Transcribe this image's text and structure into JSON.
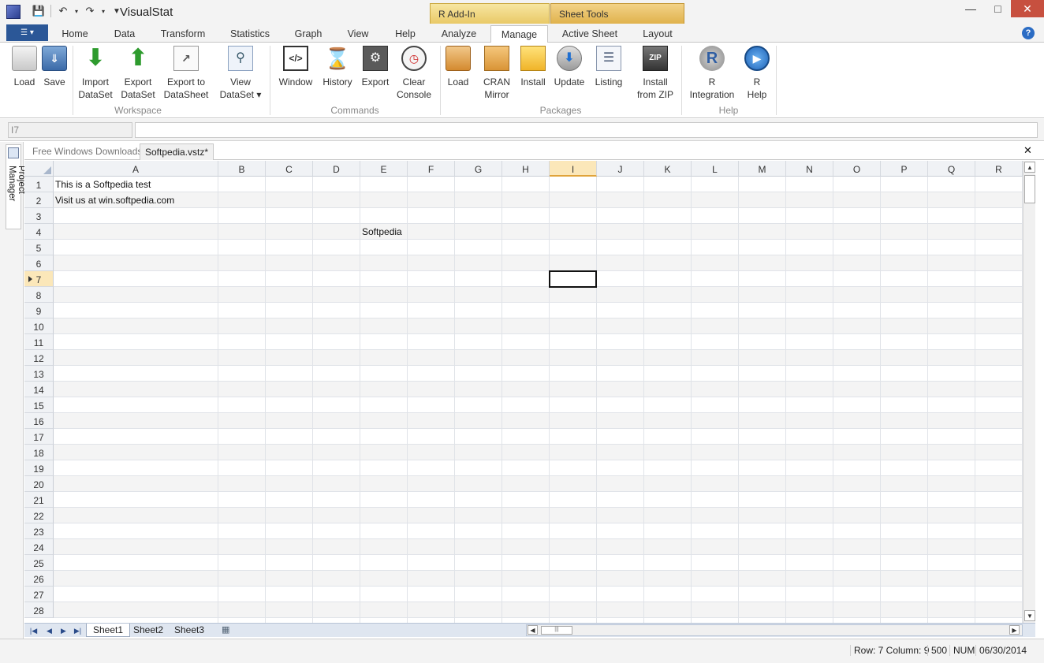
{
  "app": {
    "title": "VisualStat"
  },
  "context_groups": {
    "r_addin": "R Add-In",
    "sheet_tools": "Sheet Tools"
  },
  "tabs": [
    "Home",
    "Data",
    "Transform",
    "Statistics",
    "Graph",
    "View",
    "Help",
    "Analyze",
    "Manage",
    "Active Sheet",
    "Layout"
  ],
  "active_tab": "Manage",
  "ribbon": {
    "workspace": {
      "label": "Workspace",
      "load": "Load",
      "save": "Save",
      "import": [
        "Import",
        "DataSet"
      ],
      "export": [
        "Export",
        "DataSet"
      ],
      "export_sheet": [
        "Export to",
        "DataSheet"
      ],
      "view": [
        "View",
        "DataSet ▾"
      ]
    },
    "commands": {
      "label": "Commands",
      "window": "Window",
      "history": "History",
      "export": "Export",
      "clear": [
        "Clear",
        "Console"
      ]
    },
    "packages": {
      "label": "Packages",
      "load": "Load",
      "cran": [
        "CRAN",
        "Mirror"
      ],
      "install": "Install",
      "update": "Update",
      "listing": "Listing",
      "install_zip": [
        "Install",
        "from ZIP"
      ]
    },
    "help": {
      "label": "Help",
      "r_integration": [
        "R",
        "Integration"
      ],
      "r_help": [
        "R",
        "Help"
      ]
    }
  },
  "formula_bar": {
    "name_box": "I7",
    "formula": ""
  },
  "side_panel": {
    "label": "Project Manager"
  },
  "doc_tabs": [
    "Free Windows Downloads",
    "Softpedia.vstz*"
  ],
  "grid": {
    "columns": [
      "A",
      "B",
      "C",
      "D",
      "E",
      "F",
      "G",
      "H",
      "I",
      "J",
      "K",
      "L",
      "M",
      "N",
      "O",
      "P",
      "Q",
      "R"
    ],
    "rows": [
      "1",
      "2",
      "3",
      "4",
      "5",
      "6",
      "7",
      "8",
      "9",
      "10",
      "11",
      "12",
      "13",
      "14",
      "15",
      "16",
      "17",
      "18",
      "19",
      "20",
      "21",
      "22",
      "23",
      "24",
      "25",
      "26",
      "27",
      "28"
    ],
    "selected_column": "I",
    "selected_row": "7",
    "cells": {
      "A1": "This is a Softpedia test",
      "A2": "Visit us at win.softpedia.com",
      "E4": "Softpedia"
    }
  },
  "sheets": [
    "Sheet1",
    "Sheet2",
    "Sheet3"
  ],
  "active_sheet": "Sheet1",
  "status": {
    "position": "Row: 7 Column: 9",
    "count": "500",
    "num": "NUM",
    "date": "06/30/2014"
  }
}
